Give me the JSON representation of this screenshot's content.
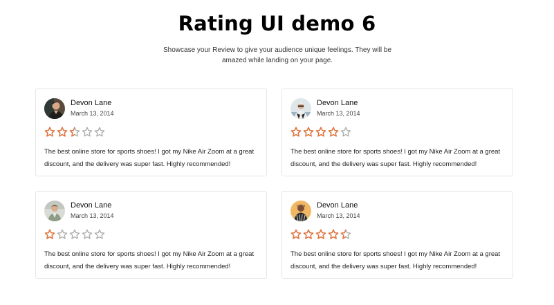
{
  "header": {
    "title": "Rating UI demo 6",
    "subtitle": "Showcase your Review to give your audience unique feelings. They will be amazed while landing on your page."
  },
  "colors": {
    "star_filled": "#e0733b",
    "star_empty": "#aaaaaa",
    "card_border": "#e6e6e6"
  },
  "reviews": [
    {
      "name": "Devon Lane",
      "date": "March 13, 2014",
      "rating": 2.5,
      "text": "The best online store for sports shoes! I got my Nike Air Zoom at a great discount, and the delivery was super fast. Highly recommended!",
      "avatar_icon": "person-avatar-icon"
    },
    {
      "name": "Devon Lane",
      "date": "March 13, 2014",
      "rating": 4,
      "text": "The best online store for sports shoes! I got my Nike Air Zoom at a great discount, and the delivery was super fast. Highly recommended!",
      "avatar_icon": "person-avatar-icon"
    },
    {
      "name": "Devon Lane",
      "date": "March 13, 2014",
      "rating": 1,
      "text": "The best online store for sports shoes! I got my Nike Air Zoom at a great discount, and the delivery was super fast. Highly recommended!",
      "avatar_icon": "person-avatar-icon"
    },
    {
      "name": "Devon Lane",
      "date": "March 13, 2014",
      "rating": 4.5,
      "text": "The best online store for sports shoes! I got my Nike Air Zoom at a great discount, and the delivery was super fast. Highly recommended!",
      "avatar_icon": "person-avatar-icon"
    }
  ]
}
